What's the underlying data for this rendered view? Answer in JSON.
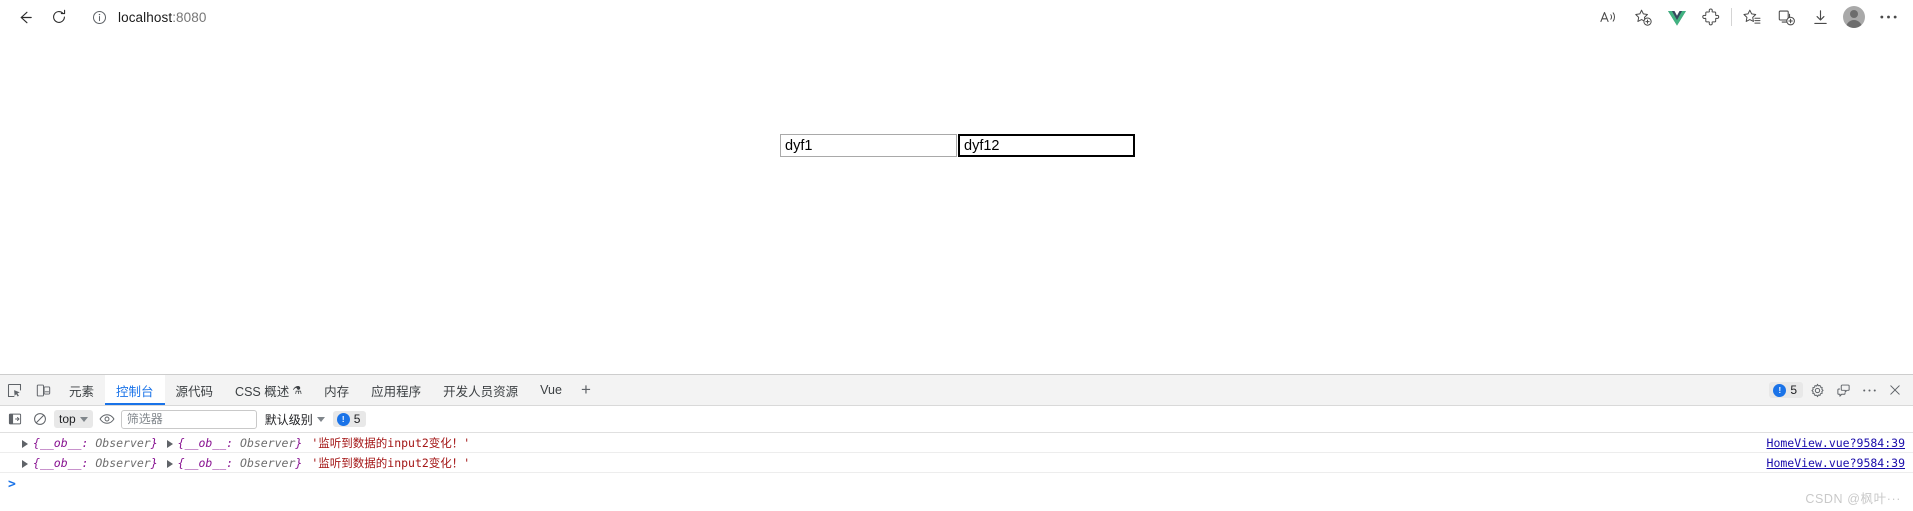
{
  "browser": {
    "back_label": "back-arrow",
    "reload_label": "reload",
    "url": "localhost",
    "url_port": ":8080",
    "url_full": "localhost:8080",
    "toolbar_icons": [
      {
        "name": "read-aloud-icon",
        "glyph": "A"
      },
      {
        "name": "add-favorite-icon",
        "glyph": "star-plus"
      },
      {
        "name": "vue-devtools-extension-icon",
        "glyph": "V",
        "color": "#42b883"
      },
      {
        "name": "extensions-puzzle-icon",
        "glyph": "puzzle"
      },
      {
        "name": "favorites-icon",
        "glyph": "star-list"
      },
      {
        "name": "collections-icon",
        "glyph": "collections"
      },
      {
        "name": "downloads-icon",
        "glyph": "download"
      },
      {
        "name": "profile-icon",
        "glyph": "avatar"
      },
      {
        "name": "settings-more-icon",
        "glyph": "..."
      }
    ]
  },
  "page": {
    "inputs": [
      {
        "name": "input-1",
        "value": "dyf1",
        "focused": false
      },
      {
        "name": "input-2",
        "value": "dyf12",
        "focused": true
      }
    ]
  },
  "devtools": {
    "tabs": [
      {
        "label": "元素",
        "active": false
      },
      {
        "label": "控制台",
        "active": true
      },
      {
        "label": "源代码",
        "active": false
      },
      {
        "label": "CSS 概述",
        "active": false,
        "flask": "⚗"
      },
      {
        "label": "内存",
        "active": false
      },
      {
        "label": "应用程序",
        "active": false
      },
      {
        "label": "开发人员资源",
        "active": false
      },
      {
        "label": "Vue",
        "active": false
      }
    ],
    "add_tab_label": "+",
    "message_badge_count": "5",
    "toolbar": {
      "context_selector": "top",
      "filter_placeholder": "筛选器",
      "filter_value": "",
      "level_selector": "默认级别",
      "issue_count": "5"
    },
    "console_rows": [
      {
        "obj1_open": "{",
        "obj1_key": "__ob__",
        "obj1_sep": ": ",
        "obj1_cls": "Observer",
        "obj1_close": "}",
        "obj2_open": "{",
        "obj2_key": "__ob__",
        "obj2_sep": ": ",
        "obj2_cls": "Observer",
        "obj2_close": "}",
        "message": "'监听到数据的input2变化！'",
        "source": "HomeView.vue?9584:39"
      },
      {
        "obj1_open": "{",
        "obj1_key": "__ob__",
        "obj1_sep": ": ",
        "obj1_cls": "Observer",
        "obj1_close": "}",
        "obj2_open": "{",
        "obj2_key": "__ob__",
        "obj2_sep": ": ",
        "obj2_cls": "Observer",
        "obj2_close": "}",
        "message": "'监听到数据的input2变化！'",
        "source": "HomeView.vue?9584:39"
      }
    ],
    "prompt_caret": ">",
    "prompt_value": ""
  },
  "watermark": "CSDN @枫叶···",
  "colors": {
    "accent": "#1a73e8",
    "vue_green": "#42b883",
    "link": "#1a0dab",
    "string": "#a31515",
    "object_key": "#881391"
  }
}
